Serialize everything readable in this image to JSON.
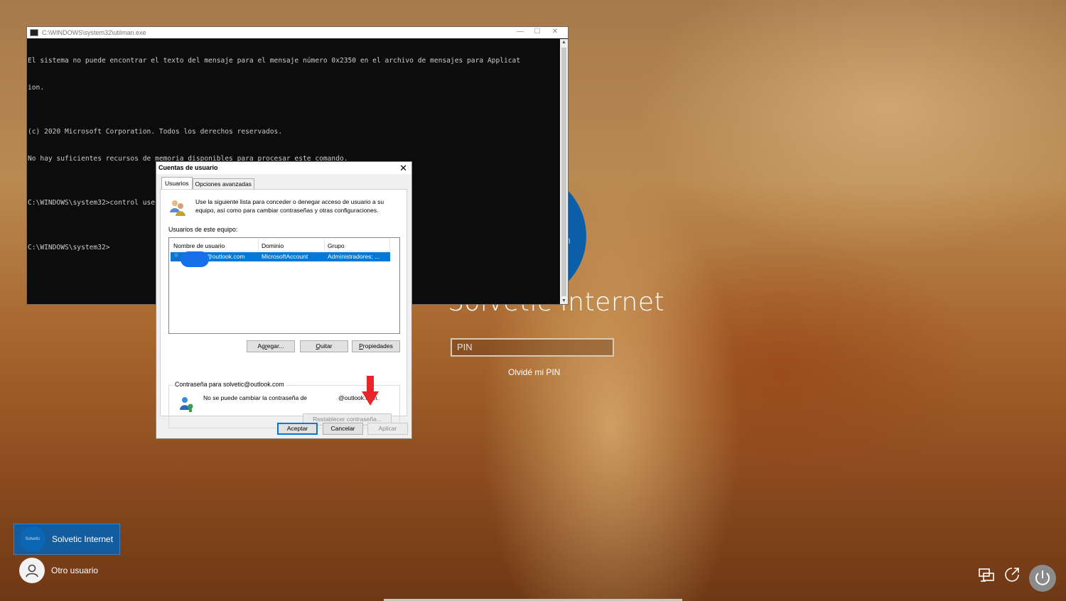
{
  "login": {
    "avatar_partial_text": "n",
    "account_name": "Solvetic Internet",
    "pin_placeholder": "PIN",
    "forgot_pin": "Olvidé mi PIN",
    "users": [
      {
        "name": "Solvetic Internet",
        "avatar_text": "Solvetic",
        "selected": true
      },
      {
        "name": "Otro usuario",
        "selected": false
      }
    ]
  },
  "console": {
    "title": "C:\\WINDOWS\\system32\\utilman.exe",
    "lines": [
      "El sistema no puede encontrar el texto del mensaje para el mensaje número 0x2350 en el archivo de mensajes para Applicat",
      "ion.",
      "",
      "(c) 2020 Microsoft Corporation. Todos los derechos reservados.",
      "No hay suficientes recursos de memoria disponibles para procesar este comando.",
      "",
      "C:\\WINDOWS\\system32>control userpasswords2",
      "",
      "C:\\WINDOWS\\system32>"
    ]
  },
  "dialog": {
    "title": "Cuentas de usuario",
    "tabs": [
      "Usuarios",
      "Opciones avanzadas"
    ],
    "intro": "Use la siguiente lista para conceder o denegar acceso de usuario a su equipo, así como para cambiar contraseñas y otras configuraciones.",
    "users_label": "Usuarios de este equipo:",
    "columns": [
      "Nombre de usuario",
      "Dominio",
      "Grupo"
    ],
    "rows": [
      {
        "user": "@outlook.com",
        "domain": "MicrosoftAccount",
        "group": "Administradores; ..."
      }
    ],
    "buttons": {
      "add": "Agregar...",
      "remove": "Quitar",
      "properties": "Propiedades"
    },
    "password_group": {
      "legend": "Contraseña para solvetic@outlook.com",
      "message": "No se puede cambiar la contraseña de",
      "domain": "@outlook.com.",
      "reset": "Restablecer contraseña..."
    },
    "footer": {
      "ok": "Aceptar",
      "cancel": "Cancelar",
      "apply": "Aplicar"
    }
  },
  "colors": {
    "accent": "#0078d7",
    "arrow": "#e8242a",
    "login_avatar": "#0a5fa8"
  }
}
